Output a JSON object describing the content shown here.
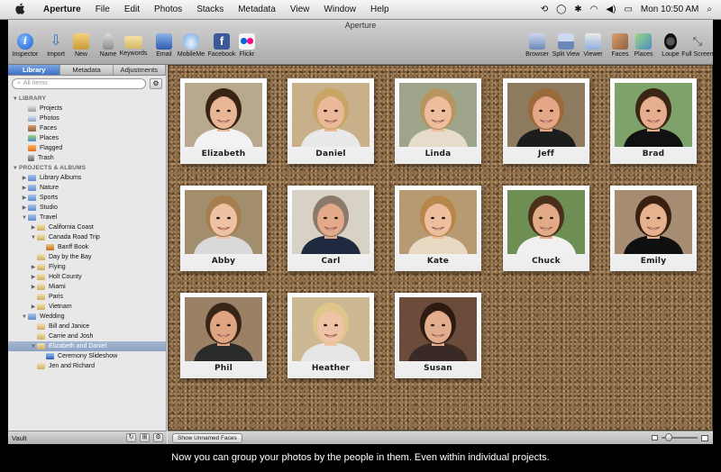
{
  "menubar": {
    "apple": "",
    "items": [
      "Aperture",
      "File",
      "Edit",
      "Photos",
      "Stacks",
      "Metadata",
      "View",
      "Window",
      "Help"
    ],
    "clock": "Mon 10:50 AM"
  },
  "window": {
    "title": "Aperture"
  },
  "toolbar": {
    "left": [
      {
        "label": "Inspector",
        "icon": "info-icon",
        "glyph": "i"
      },
      {
        "label": "Import",
        "icon": "import-arrow-icon",
        "glyph": "⇩"
      },
      {
        "label": "New",
        "icon": "new-folder-icon",
        "glyph": ""
      },
      {
        "label": "Name",
        "icon": "person-icon",
        "glyph": ""
      },
      {
        "label": "Keywords",
        "icon": "keyword-tag-icon",
        "glyph": ""
      },
      {
        "label": "Email",
        "icon": "mail-icon",
        "glyph": ""
      },
      {
        "label": "MobileMe",
        "icon": "cloud-icon",
        "glyph": ""
      },
      {
        "label": "Facebook",
        "icon": "facebook-icon",
        "glyph": "f"
      },
      {
        "label": "Flickr",
        "icon": "flickr-icon",
        "glyph": ""
      }
    ],
    "right": [
      {
        "label": "Browser",
        "icon": "browser-view-icon",
        "glyph": ""
      },
      {
        "label": "Split View",
        "icon": "split-view-icon",
        "glyph": ""
      },
      {
        "label": "Viewer",
        "icon": "viewer-icon",
        "glyph": ""
      },
      {
        "label": "Faces",
        "icon": "faces-icon",
        "glyph": ""
      },
      {
        "label": "Places",
        "icon": "places-icon",
        "glyph": ""
      },
      {
        "label": "Loupe",
        "icon": "loupe-icon",
        "glyph": ""
      },
      {
        "label": "Full Screen",
        "icon": "fullscreen-icon",
        "glyph": "⤡"
      }
    ]
  },
  "sidebar": {
    "tabs": [
      "Library",
      "Metadata",
      "Adjustments"
    ],
    "active_tab": "Library",
    "search_placeholder": "All Items",
    "tree": [
      {
        "label": "LIBRARY",
        "type": "section",
        "indent": 0,
        "tri": "▼"
      },
      {
        "label": "Projects",
        "type": "project",
        "indent": 1
      },
      {
        "label": "Photos",
        "type": "photos",
        "indent": 1
      },
      {
        "label": "Faces",
        "type": "faces",
        "indent": 1
      },
      {
        "label": "Places",
        "type": "places",
        "indent": 1
      },
      {
        "label": "Flagged",
        "type": "flag",
        "indent": 1
      },
      {
        "label": "Trash",
        "type": "trash",
        "indent": 1
      },
      {
        "label": "PROJECTS & ALBUMS",
        "type": "section",
        "indent": 0,
        "tri": "▼"
      },
      {
        "label": "Library Albums",
        "type": "folder",
        "indent": 1,
        "tri": "▶"
      },
      {
        "label": "Nature",
        "type": "folder",
        "indent": 1,
        "tri": "▶"
      },
      {
        "label": "Sports",
        "type": "folder",
        "indent": 1,
        "tri": "▶"
      },
      {
        "label": "Studio",
        "type": "folder",
        "indent": 1,
        "tri": "▶"
      },
      {
        "label": "Travel",
        "type": "folder",
        "indent": 1,
        "tri": "▼"
      },
      {
        "label": "California Coast",
        "type": "album",
        "indent": 2,
        "tri": "▶"
      },
      {
        "label": "Canada Road Trip",
        "type": "album",
        "indent": 2,
        "tri": "▼"
      },
      {
        "label": "Banff Book",
        "type": "book",
        "indent": 3
      },
      {
        "label": "Day by the Bay",
        "type": "album",
        "indent": 2
      },
      {
        "label": "Flying",
        "type": "album",
        "indent": 2,
        "tri": "▶"
      },
      {
        "label": "Holt County",
        "type": "album",
        "indent": 2,
        "tri": "▶"
      },
      {
        "label": "Miami",
        "type": "album",
        "indent": 2,
        "tri": "▶"
      },
      {
        "label": "Paris",
        "type": "album",
        "indent": 2
      },
      {
        "label": "Vietnam",
        "type": "album",
        "indent": 2,
        "tri": "▶"
      },
      {
        "label": "Wedding",
        "type": "folder",
        "indent": 1,
        "tri": "▼"
      },
      {
        "label": "Bill and Janice",
        "type": "album",
        "indent": 2
      },
      {
        "label": "Carrie and Josh",
        "type": "album",
        "indent": 2
      },
      {
        "label": "Elizabeth and Daniel",
        "type": "album",
        "indent": 2,
        "tri": "▼",
        "selected": true
      },
      {
        "label": "Ceremony Slideshow",
        "type": "slideshow",
        "indent": 3
      },
      {
        "label": "Jen and Richard",
        "type": "album",
        "indent": 2
      }
    ],
    "vault_label": "Vault"
  },
  "faces": [
    {
      "name": "Elizabeth",
      "skin": "#e8b896",
      "hair": "#3a2414",
      "bg": "#b8a98e",
      "shirt": "#f2f2f2"
    },
    {
      "name": "Daniel",
      "skin": "#eab999",
      "hair": "#c9a564",
      "bg": "#c8b08a",
      "shirt": "#e9e9e9"
    },
    {
      "name": "Linda",
      "skin": "#edbd9e",
      "hair": "#b7955f",
      "bg": "#9ea58a",
      "shirt": "#e7dccb"
    },
    {
      "name": "Jeff",
      "skin": "#e4a888",
      "hair": "#9a6a3a",
      "bg": "#8e7a5e",
      "shirt": "#1d1d1d"
    },
    {
      "name": "Brad",
      "skin": "#e5ae8e",
      "hair": "#3b2616",
      "bg": "#7ea36a",
      "shirt": "#111111"
    },
    {
      "name": "Abby",
      "skin": "#edc2a3",
      "hair": "#a77e4e",
      "bg": "#a28e6d",
      "shirt": "#d9d9d9"
    },
    {
      "name": "Carl",
      "skin": "#e2aa8a",
      "hair": "#8b7a6a",
      "bg": "#d8d2c6",
      "shirt": "#1f2a40"
    },
    {
      "name": "Kate",
      "skin": "#edbf9f",
      "hair": "#b68748",
      "bg": "#b89a72",
      "shirt": "#e8d9c2"
    },
    {
      "name": "Chuck",
      "skin": "#e2aa86",
      "hair": "#4a2f1b",
      "bg": "#6e8f54",
      "shirt": "#f0f0f0"
    },
    {
      "name": "Emily",
      "skin": "#e5b18f",
      "hair": "#3a2010",
      "bg": "#a58c73",
      "shirt": "#101010"
    },
    {
      "name": "Phil",
      "skin": "#dfa583",
      "hair": "#3a2617",
      "bg": "#9a8166",
      "shirt": "#2a2a2a"
    },
    {
      "name": "Heather",
      "skin": "#efc3a5",
      "hair": "#e0c58a",
      "bg": "#cdb894",
      "shirt": "#e6e6e6"
    },
    {
      "name": "Susan",
      "skin": "#e2ad8c",
      "hair": "#2d1a10",
      "bg": "#6b4b3a",
      "shirt": "#3a2a26"
    }
  ],
  "bottombar": {
    "unnamed_button": "Show Unnamed Faces",
    "zoom_level": 0.2
  },
  "caption": "Now you can group your photos by the people in them. Even within individual projects."
}
